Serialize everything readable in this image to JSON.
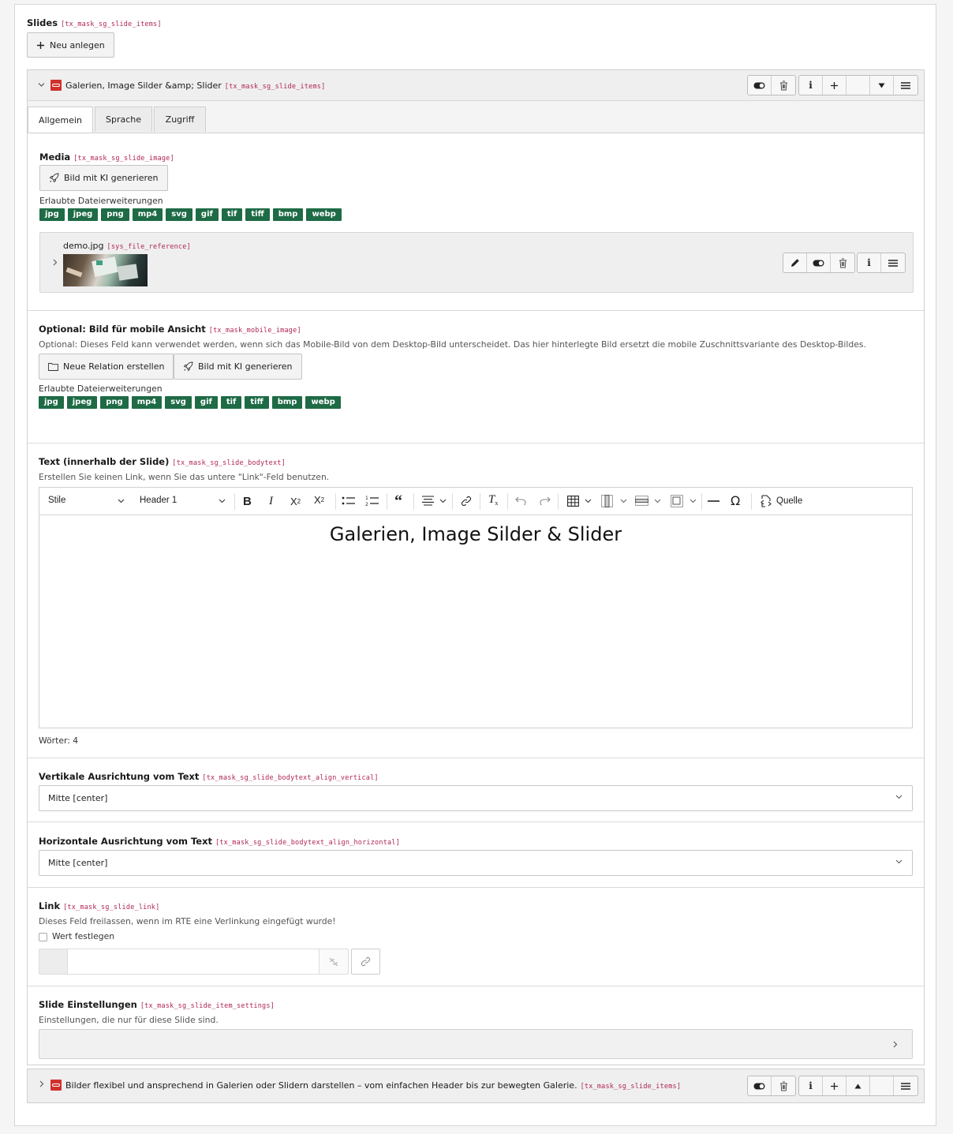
{
  "slides": {
    "label": "Slides",
    "code": "[tx_mask_sg_slide_items]",
    "new_label": "Neu anlegen"
  },
  "item1": {
    "title": "Galerien, Image Silder &amp; Slider",
    "code": "[tx_mask_sg_slide_items]"
  },
  "tabs": [
    {
      "label": "Allgemein"
    },
    {
      "label": "Sprache"
    },
    {
      "label": "Zugriff"
    }
  ],
  "media": {
    "label": "Media",
    "code": "[tx_mask_sg_slide_image]",
    "ai_label": "Bild mit KI generieren",
    "ext_label": "Erlaubte Dateierweiterungen",
    "file": {
      "name": "demo.jpg",
      "code": "[sys_file_reference]"
    }
  },
  "extensions": [
    "jpg",
    "jpeg",
    "png",
    "mp4",
    "svg",
    "gif",
    "tif",
    "tiff",
    "bmp",
    "webp"
  ],
  "mobile": {
    "label": "Optional: Bild für mobile Ansicht",
    "code": "[tx_mask_mobile_image]",
    "desc": "Optional: Dieses Feld kann verwendet werden, wenn sich das Mobile-Bild von dem Desktop-Bild unterscheidet. Das hier hinterlegte Bild ersetzt die mobile Zuschnittsvariante des Desktop-Bildes.",
    "relation_label": "Neue Relation erstellen",
    "ai_label": "Bild mit KI generieren",
    "ext_label": "Erlaubte Dateierweiterungen"
  },
  "text": {
    "label": "Text (innerhalb der Slide)",
    "code": "[tx_mask_sg_slide_bodytext]",
    "desc": "Erstellen Sie keinen Link, wenn Sie das untere \"Link\"-Feld benutzen.",
    "style_select": "Stile",
    "heading_select": "Header 1",
    "source_label": "Quelle",
    "content": "Galerien, Image Silder & Slider",
    "word_count": "Wörter: 4"
  },
  "valign": {
    "label": "Vertikale Ausrichtung vom Text",
    "code": "[tx_mask_sg_slide_bodytext_align_vertical]",
    "value": "Mitte [center]"
  },
  "halign": {
    "label": "Horizontale Ausrichtung vom Text",
    "code": "[tx_mask_sg_slide_bodytext_align_horizontal]",
    "value": "Mitte [center]"
  },
  "link": {
    "label": "Link",
    "code": "[tx_mask_sg_slide_link]",
    "desc": "Dieses Feld freilassen, wenn im RTE eine Verlinkung eingefügt wurde!",
    "checkbox_label": "Wert festlegen",
    "value": ""
  },
  "settings": {
    "label": "Slide Einstellungen",
    "code": "[tx_mask_sg_slide_item_settings]",
    "desc": "Einstellungen, die nur für diese Slide sind."
  },
  "item2": {
    "title": "Bilder flexibel und ansprechend in Galerien oder Slidern darstellen – vom einfachen Header bis zur bewegten Galerie.",
    "code": "[tx_mask_sg_slide_items]"
  },
  "colors": {
    "accent": "#b02650",
    "ext_badge": "#1e6b46",
    "record_icon": "#d0312d"
  }
}
